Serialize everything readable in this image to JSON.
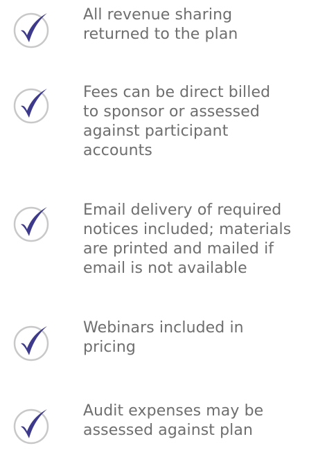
{
  "colors": {
    "text": "#6e6e6e",
    "check": "#3d3a8c",
    "circle": "#c8c8c8"
  },
  "features": [
    {
      "icon": "checkmark-circle-icon",
      "text": "All revenue sharing\nreturned to the plan"
    },
    {
      "icon": "checkmark-circle-icon",
      "text": "Fees can be direct billed\nto sponsor or assessed\nagainst participant\naccounts"
    },
    {
      "icon": "checkmark-circle-icon",
      "text": "Email delivery of required\nnotices included; materials\nare printed and mailed if\nemail is not available"
    },
    {
      "icon": "checkmark-circle-icon",
      "text": "Webinars included in\npricing"
    },
    {
      "icon": "checkmark-circle-icon",
      "text": "Audit expenses may be\nassessed against plan"
    }
  ]
}
